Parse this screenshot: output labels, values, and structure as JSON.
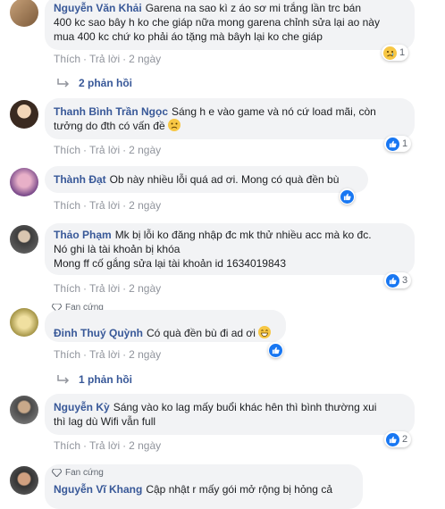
{
  "comments": [
    {
      "name": "Nguyễn Văn Khải",
      "text_line1": "Garena na sao kì z áo sơ mi trắng lần trc bán",
      "text_line2": "400 kc sao bây h ko che giáp nữa mong garena chỉnh sửa lại ao này",
      "text_line3": "mua 400 kc chứ ko phải áo tặng mà bâyh lại ko che giáp",
      "like": "Thích",
      "reply": "Trả lời",
      "time": "2 ngày",
      "reaction_count": "1",
      "reaction_type": "sad-icon"
    },
    {
      "name": "Thanh Bình Trần Ngọc",
      "text_line1": "Sáng h e vào game và nó cứ load mãi, còn",
      "text_line2": "tưởng do đth có vấn đề",
      "like": "Thích",
      "reply": "Trả lời",
      "time": "2 ngày",
      "reaction_count": "1",
      "reaction_type": "like-icon"
    },
    {
      "name": "Thành Đạt",
      "text_line1": "Ob này nhiều lỗi quá ad ơi. Mong có quà đền bù",
      "like": "Thích",
      "reply": "Trả lời",
      "time": "2 ngày",
      "reaction_count": "",
      "reaction_type": "like-icon"
    },
    {
      "name": "Thảo Phạm",
      "text_line1": "Mk bị lỗi ko đăng nhập đc mk thử nhiều acc mà ko đc.",
      "text_line2": "Nó ghi là tài khoản bị khóa",
      "text_line3": "Mong ff cố gắng sửa lại tài khoản id 1634019843",
      "like": "Thích",
      "reply": "Trả lời",
      "time": "2 ngày",
      "reaction_count": "3",
      "reaction_type": "like-icon"
    },
    {
      "badge": "Fan cứng",
      "name": "Đinh Thuý Quỳnh",
      "text_line1": "Có quà đền bù đi ad ơi",
      "like": "Thích",
      "reply": "Trả lời",
      "time": "2 ngày",
      "reaction_count": "",
      "reaction_type": "like-icon"
    },
    {
      "name": "Nguyễn Kỳ",
      "text_line1": "Sáng vào ko lag mấy buổi khác hên thì bình thường xui",
      "text_line2": "thì lag dù Wifi vẫn full",
      "like": "Thích",
      "reply": "Trả lời",
      "time": "2 ngày",
      "reaction_count": "2",
      "reaction_type": "like-icon"
    },
    {
      "badge": "Fan cứng",
      "name": "Nguyễn Vĩ Khang",
      "text_line1": "Cập nhật r mấy gói mở rộng bị hỏng cả",
      "reaction_type": "like-icon"
    }
  ],
  "reply_links": [
    {
      "label": "2 phản hồi"
    },
    {
      "label": "1 phản hồi"
    }
  ],
  "colors": {
    "name": "#385898",
    "bubble": "#f2f3f5",
    "meta": "#90949c",
    "like": "#1877f2"
  }
}
